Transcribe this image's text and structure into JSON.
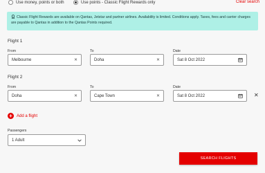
{
  "payment_options": [
    {
      "label": "Use money, points or both",
      "selected": false
    },
    {
      "label": "Use points - Classic Flight Rewards only",
      "selected": true
    }
  ],
  "clear_search": "Clear search",
  "notice": {
    "icon": "award-icon",
    "text": "Classic Flight Rewards are available on Qantas, Jetstar and partner airlines. Availability is limited. Conditions apply. Taxes, fees and carrier charges are payable to Qantas in addition to the Qantas Points required."
  },
  "flights": [
    {
      "title": "Flight 1",
      "from_label": "From",
      "from": "Melbourne",
      "to_label": "To",
      "to": "Doha",
      "date_label": "Date",
      "date": "Sat 8 Oct 2022"
    },
    {
      "title": "Flight 2",
      "from_label": "From",
      "from": "Doha",
      "to_label": "To",
      "to": "Cape Town",
      "date_label": "Date",
      "date": "Sat 8 Oct 2022"
    }
  ],
  "add_flight": "Add a flight",
  "passengers": {
    "label": "Passengers",
    "value": "1 Adult"
  },
  "search_button": "SEARCH FLIGHTS",
  "colors": {
    "accent": "#e40000",
    "notice_bg": "#aef0e6"
  }
}
